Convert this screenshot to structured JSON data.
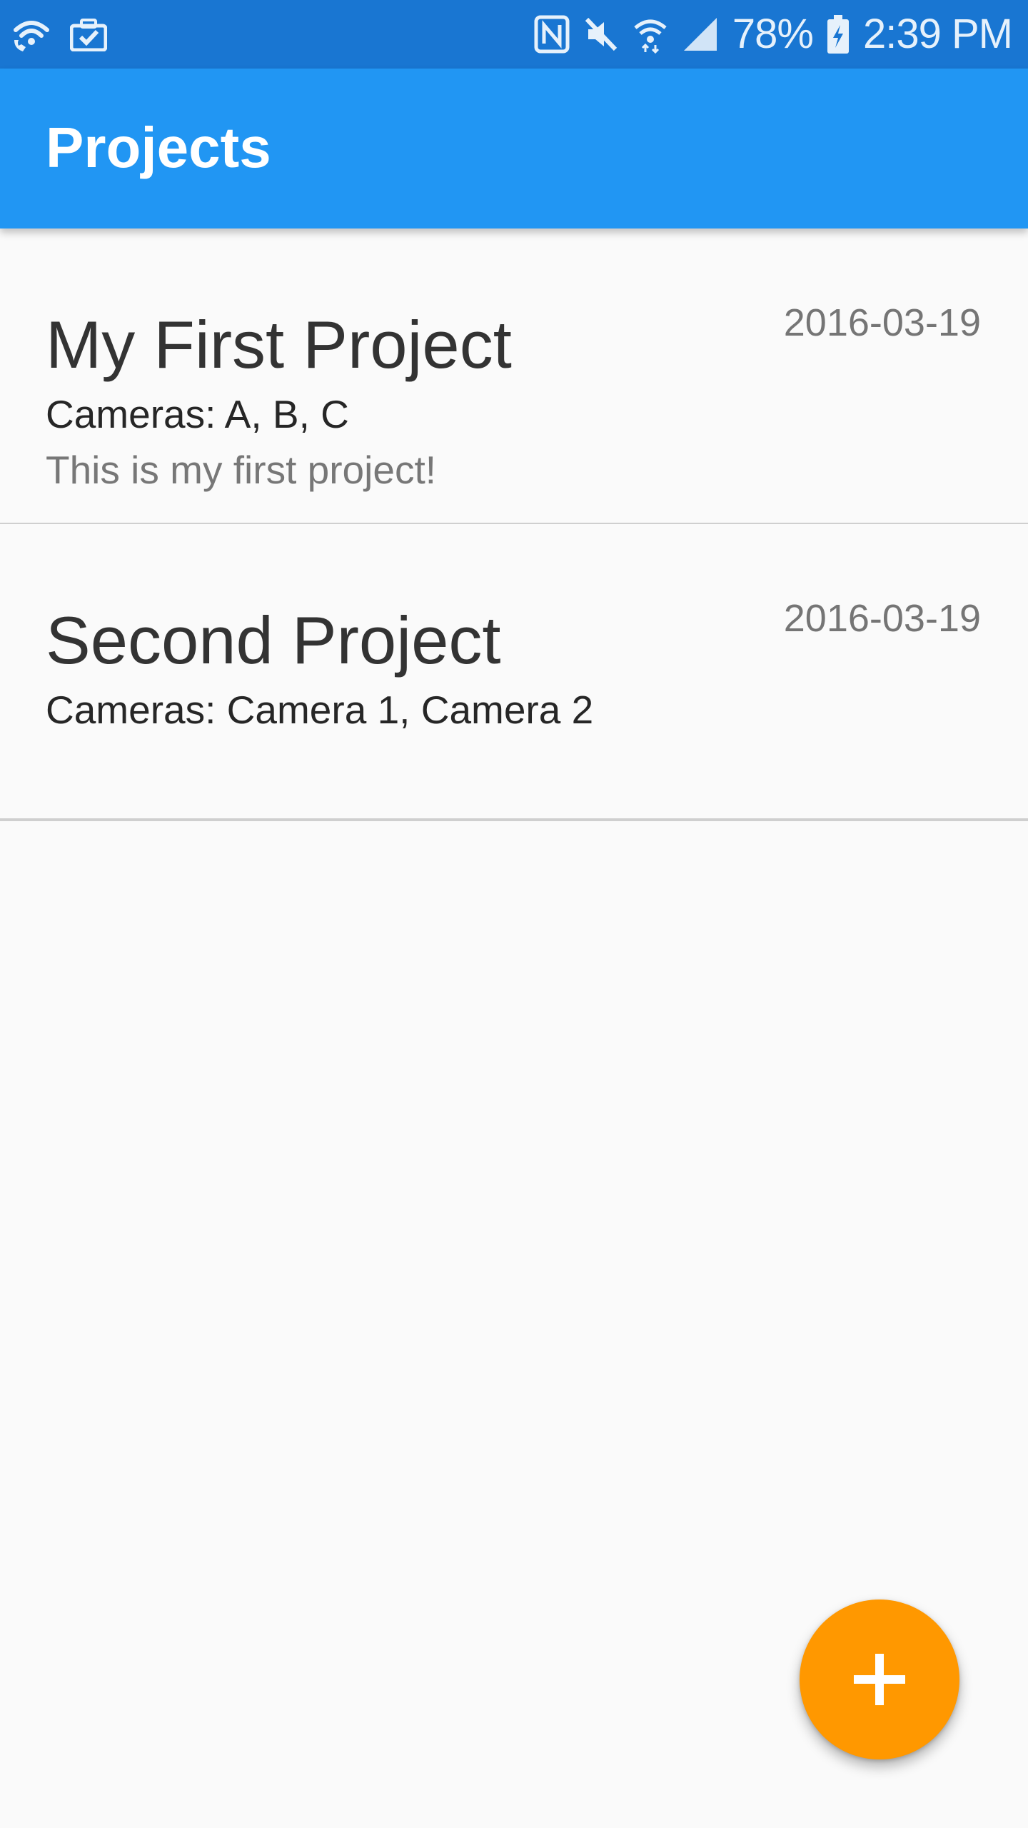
{
  "status_bar": {
    "icons_left": [
      "wifi-call-icon",
      "briefcase-check-icon"
    ],
    "icons_right": [
      "nfc-icon",
      "mute-icon",
      "wifi-icon",
      "signal-icon",
      "battery-charging-icon"
    ],
    "battery_percent": "78%",
    "time": "2:39 PM"
  },
  "app_bar": {
    "title": "Projects"
  },
  "projects": [
    {
      "name": "My First Project",
      "date": "2016-03-19",
      "cameras": "Cameras: A, B, C",
      "description": "This is my first project!"
    },
    {
      "name": "Second Project",
      "date": "2016-03-19",
      "cameras": "Cameras: Camera 1, Camera 2",
      "description": ""
    }
  ],
  "fab": {
    "icon": "plus-icon"
  },
  "colors": {
    "status_bar": "#1976d2",
    "app_bar": "#2196f3",
    "fab": "#ff9800",
    "background": "#fafafa"
  }
}
